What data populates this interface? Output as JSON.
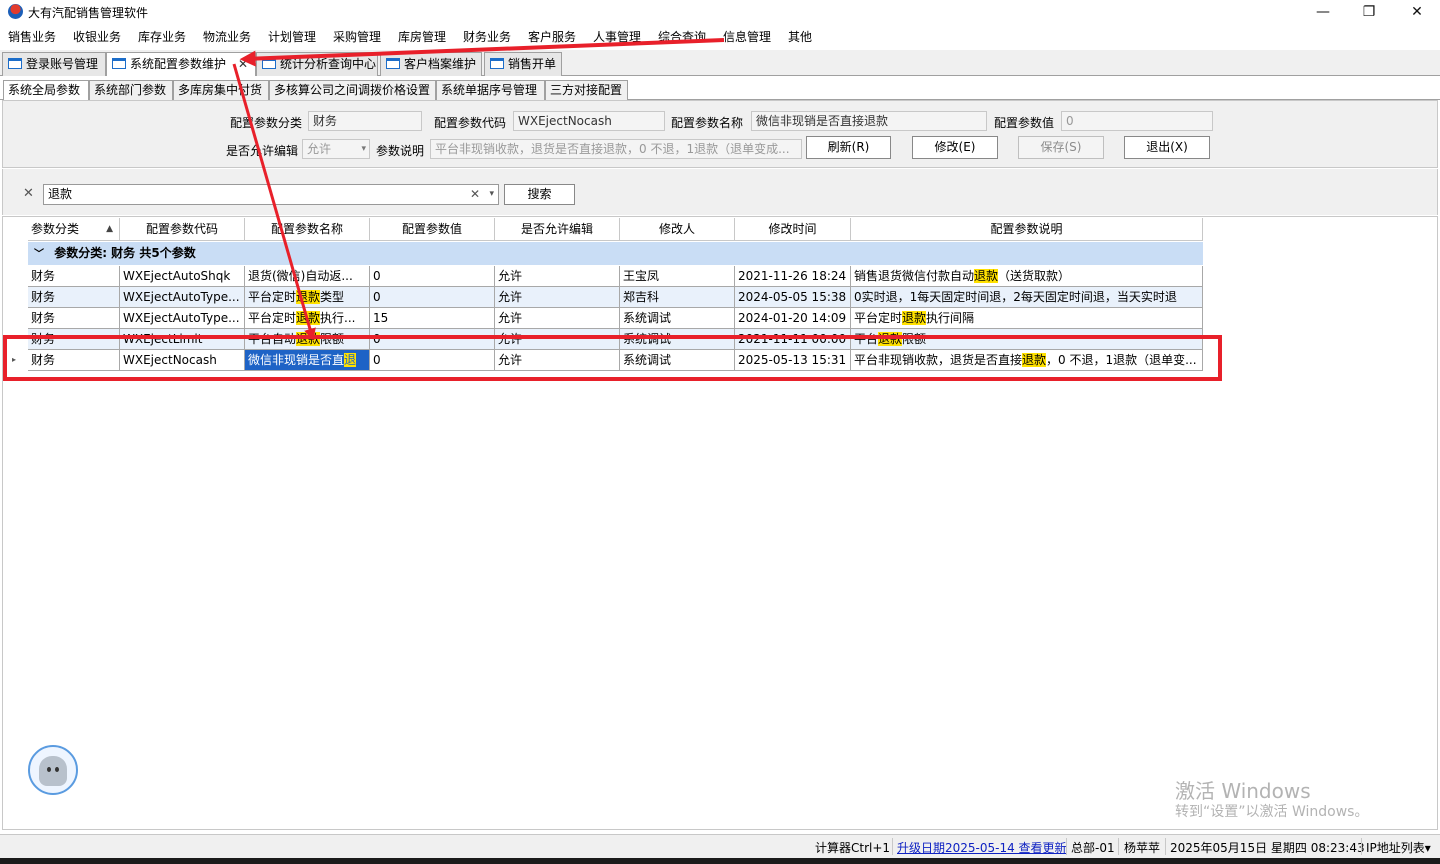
{
  "app": {
    "title": "大有汽配销售管理软件"
  },
  "window_controls": {
    "minimize": "—",
    "maximize": "❐",
    "close": "✕"
  },
  "menu": [
    "销售业务",
    "收银业务",
    "库存业务",
    "物流业务",
    "计划管理",
    "采购管理",
    "库房管理",
    "财务业务",
    "客户服务",
    "人事管理",
    "综合查询",
    "信息管理",
    "其他"
  ],
  "doc_tabs": [
    "登录账号管理",
    "系统配置参数维护",
    "统计分析查询中心",
    "客户档案维护",
    "销售开单"
  ],
  "doc_tab_close": "✕",
  "sub_tabs": [
    "系统全局参数",
    "系统部门参数",
    "多库房集中付货",
    "多核算公司之间调拨价格设置",
    "系统单据序号管理",
    "三方对接配置"
  ],
  "form": {
    "category_label": "配置参数分类",
    "category_value": "财务",
    "code_label": "配置参数代码",
    "code_value": "WXEjectNocash",
    "name_label": "配置参数名称",
    "name_value": "微信非现销是否直接退款",
    "value_label": "配置参数值",
    "value_value": "0",
    "editable_label": "是否允许编辑",
    "editable_value": "允许",
    "desc_label": "参数说明",
    "desc_value": "平台非现销收款，退货是否直接退款，0 不退，1退款（退单变成...",
    "refresh": "刷新(R)",
    "modify": "修改(E)",
    "save": "保存(S)",
    "exit": "退出(X)"
  },
  "search": {
    "clear": "✕",
    "value": "退款",
    "input_clear": "✕",
    "dropdown": "▾",
    "button": "搜索"
  },
  "grid": {
    "columns": [
      "参数分类",
      "配置参数代码",
      "配置参数名称",
      "配置参数值",
      "是否允许编辑",
      "修改人",
      "修改时间",
      "配置参数说明"
    ],
    "sort_indicator": "▲",
    "group_label": "参数分类: 财务 共5个参数",
    "group_chevron": "﹀",
    "row_marker": "▸",
    "rows": [
      {
        "category": "财务",
        "code": "WXEjectAutoShqk",
        "name_pre": "退货(微信)自动返...",
        "name_hl": "",
        "name_post": "",
        "value": "0",
        "editable": "允许",
        "modifier": "王宝凤",
        "time": "2021-11-26 18:24",
        "desc_pre": "销售退货微信付款自动",
        "desc_hl": "退款",
        "desc_post": "（送货取款）"
      },
      {
        "category": "财务",
        "code": "WXEjectAutoType...",
        "name_pre": "平台定时",
        "name_hl": "退款",
        "name_post": "类型",
        "value": "0",
        "editable": "允许",
        "modifier": "郑吉科",
        "time": "2024-05-05 15:38",
        "desc_pre": "0实时退，1每天固定时间退，2每天固定时间退，当天实时退",
        "desc_hl": "",
        "desc_post": ""
      },
      {
        "category": "财务",
        "code": "WXEjectAutoType...",
        "name_pre": "平台定时",
        "name_hl": "退款",
        "name_post": "执行...",
        "value": "15",
        "editable": "允许",
        "modifier": "系统调试",
        "time": "2024-01-20 14:09",
        "desc_pre": "平台定时",
        "desc_hl": "退款",
        "desc_post": "执行间隔"
      },
      {
        "category": "财务",
        "code": "WXEjectLimit",
        "name_pre": "平台自动",
        "name_hl": "退款",
        "name_post": "限额",
        "value": "0",
        "editable": "允许",
        "modifier": "系统调试",
        "time": "2021-11-11 00:00",
        "desc_pre": "平台",
        "desc_hl": "退款",
        "desc_post": "限额"
      },
      {
        "category": "财务",
        "code": "WXEjectNocash",
        "name_pre": "微信非现销是否直",
        "name_hl": "退",
        "name_post": "",
        "value": "0",
        "editable": "允许",
        "modifier": "系统调试",
        "time": "2025-05-13 15:31",
        "desc_pre": "平台非现销收款，退货是否直接",
        "desc_hl": "退款",
        "desc_post": "，0 不退，1退款（退单变..."
      }
    ]
  },
  "watermark": {
    "title": "激活 Windows",
    "subtitle": "转到“设置”以激活 Windows。"
  },
  "status": {
    "calculator": "计算器Ctrl+1",
    "update": "升级日期2025-05-14 查看更新",
    "dept": "总部-01",
    "user": "杨苹苹",
    "datetime": "2025年05月15日 星期四 08:23:43",
    "ip_list": "IP地址列表",
    "ip_arrow": "▾"
  },
  "colors": {
    "accent": "#1e63c6",
    "highlight": "#ffe100",
    "annotation": "#e8202a",
    "group_bg": "#c9ddf5"
  },
  "icons": {
    "app": "app-logo-icon",
    "tab": "window-icon",
    "bot": "assistant-bot-icon"
  }
}
